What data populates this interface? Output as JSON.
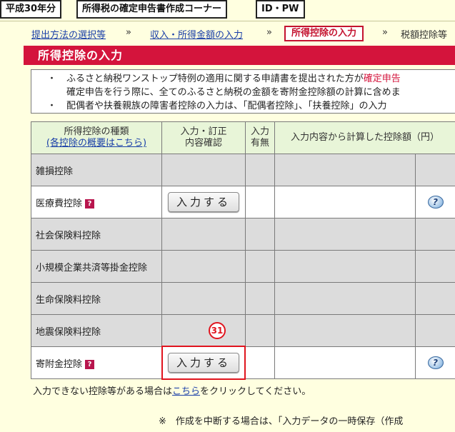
{
  "topbar": {
    "year": "平成30年分",
    "title": "所得税の確定申告書作成コーナー",
    "id_pw": "ID・PW"
  },
  "breadcrumb": {
    "step1": "提出方法の選択等",
    "step2": "収入・所得金額の入力",
    "current": "所得控除の入力",
    "next": "税額控除等",
    "sep": "»"
  },
  "section_title": "所得控除の入力",
  "notice": {
    "bullet": "・",
    "line1_pre": "ふるさと納税ワンストップ特例の適用に関する申請書を提出された方が",
    "line1_red": "確定申告",
    "line2": "確定申告を行う際に、全てのふるさと納税の金額を寄附金控除額の計算に含めま",
    "line3": "配偶者や扶養親族の障害者控除の入力は、「配偶者控除」、「扶養控除」の入力"
  },
  "table": {
    "headers": {
      "type_line1": "所得控除の種類",
      "type_link": "(各控除の概要はこちら)",
      "input_line1": "入力・訂正",
      "input_line2": "内容確認",
      "has_line1": "入力",
      "has_line2": "有無",
      "amount": "入力内容から計算した控除額（円）"
    },
    "rows": [
      {
        "name": "雑損控除"
      },
      {
        "name": "医療費控除"
      },
      {
        "name": "社会保険料控除"
      },
      {
        "name": "小規模企業共済等掛金控除"
      },
      {
        "name": "生命保険料控除"
      },
      {
        "name": "地震保険料控除"
      },
      {
        "name": "寄附金控除"
      }
    ],
    "input_button": "入力する",
    "q_icon": "?",
    "help_icon": "?"
  },
  "step_marker": "31",
  "footer": {
    "pre": "入力できない控除等がある場合は",
    "link": "こちら",
    "post": "をクリックしてください。",
    "note": "※　作成を中断する場合は、「入力データの一時保存（作成"
  },
  "colors": {
    "accent_red": "#d4143c",
    "header_green": "#e8f5d8",
    "link_blue": "#1a3fa8",
    "background": "#ffffe0"
  }
}
